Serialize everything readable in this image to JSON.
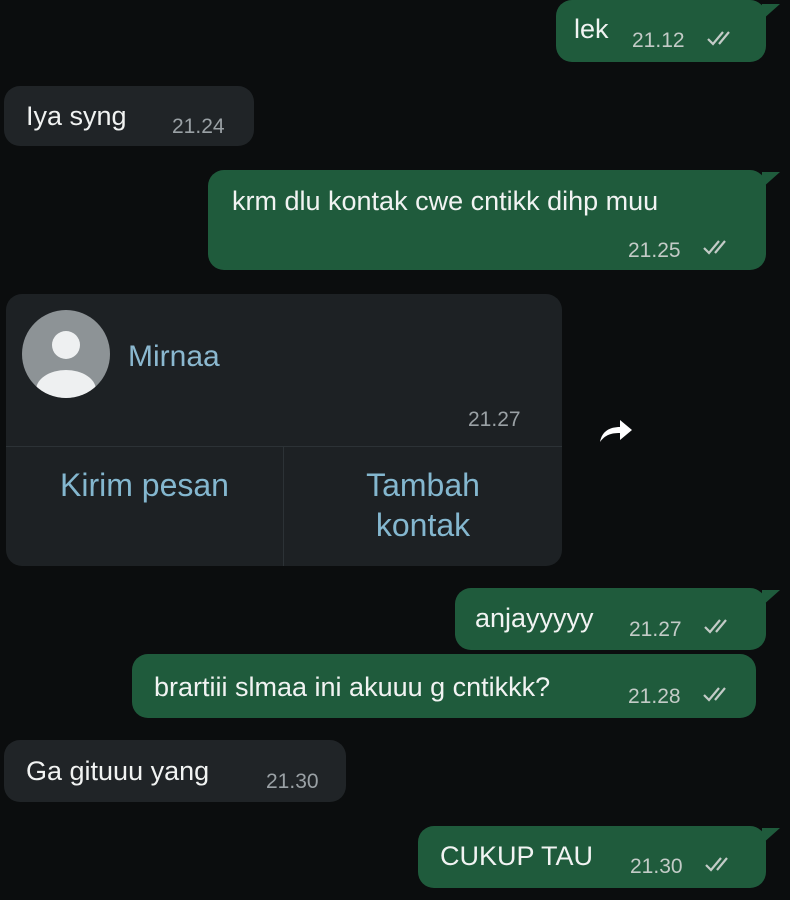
{
  "messages": [
    {
      "id": "m1",
      "direction": "out",
      "text": "lek",
      "time": "21.12",
      "ticks": true
    },
    {
      "id": "m2",
      "direction": "in",
      "text": "Iya syng",
      "time": "21.24"
    },
    {
      "id": "m3",
      "direction": "out",
      "text": "krm dlu kontak cwe cntikk dihp muu",
      "time": "21.25",
      "ticks": true
    },
    {
      "id": "m5",
      "direction": "out",
      "text": "anjayyyyy",
      "time": "21.27",
      "ticks": true
    },
    {
      "id": "m6",
      "direction": "out",
      "text": "brartiii slmaa ini akuuu g cntikkk?",
      "time": "21.28",
      "ticks": true
    },
    {
      "id": "m7",
      "direction": "in",
      "text": "Ga gituuu yang",
      "time": "21.30"
    },
    {
      "id": "m8",
      "direction": "out",
      "text": "CUKUP TAU",
      "time": "21.30",
      "ticks": true
    }
  ],
  "contact_card": {
    "name": "Mirnaa",
    "time": "21.27",
    "send_message_label": "Kirim pesan",
    "add_contact_line1": "Tambah",
    "add_contact_line2": "kontak",
    "avatar_icon": "default-avatar-icon",
    "forward_icon": "forward-arrow-icon"
  },
  "colors": {
    "background": "#0b0d0e",
    "outgoing_bubble": "#1f5b3c",
    "incoming_bubble": "#202427",
    "link_blue": "#84b7cf"
  }
}
